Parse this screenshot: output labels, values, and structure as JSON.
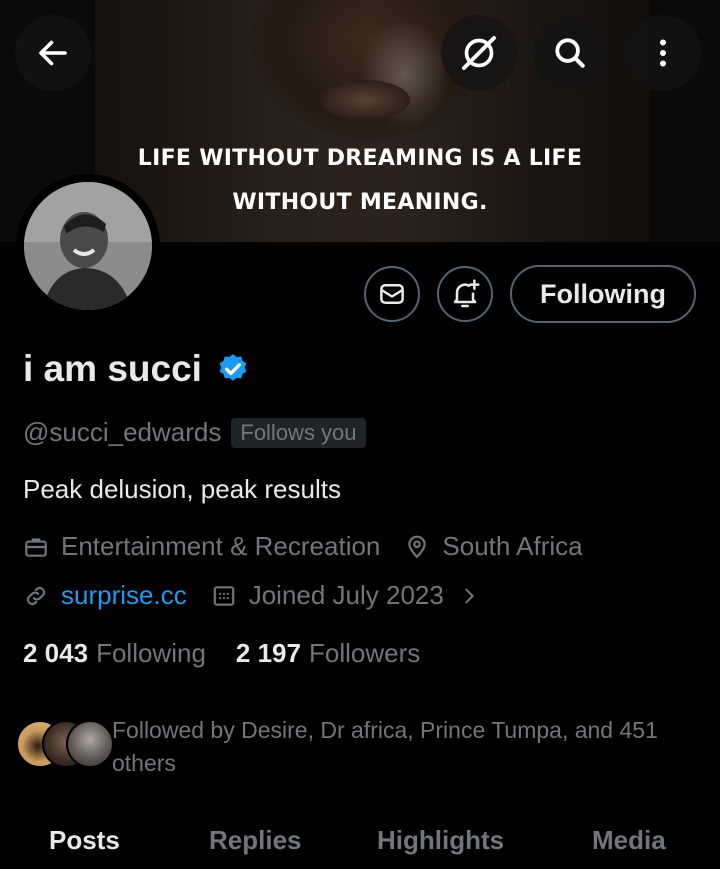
{
  "banner": {
    "quote_line1": "LIFE WITHOUT DREAMING IS A LIFE",
    "quote_line2": "WITHOUT MEANING."
  },
  "header_icons": {
    "back": "arrow-left-icon",
    "grok": "grok-icon",
    "search": "search-icon",
    "more": "more-vertical-icon"
  },
  "profile": {
    "display_name": "i am succi",
    "handle": "@succi_edwards",
    "follows_you": "Follows you",
    "bio": "Peak delusion, peak results",
    "category": "Entertainment & Recreation",
    "location": "South Africa",
    "website": "surprise.cc",
    "joined": "Joined July 2023"
  },
  "actions": {
    "following_label": "Following"
  },
  "stats": {
    "following_count": "2 043",
    "following_label": "Following",
    "followers_count": "2 197",
    "followers_label": "Followers"
  },
  "followed_by": {
    "text": "Followed by Desire, Dr africa, Prince Tumpa, and 451 others"
  },
  "tabs": [
    {
      "label": "Posts",
      "active": true
    },
    {
      "label": "Replies",
      "active": false
    },
    {
      "label": "Highlights",
      "active": false
    },
    {
      "label": "Media",
      "active": false
    }
  ],
  "colors": {
    "accent": "#1d9bf0",
    "muted": "#71767b",
    "text": "#e7e9ea",
    "border": "#536471"
  }
}
